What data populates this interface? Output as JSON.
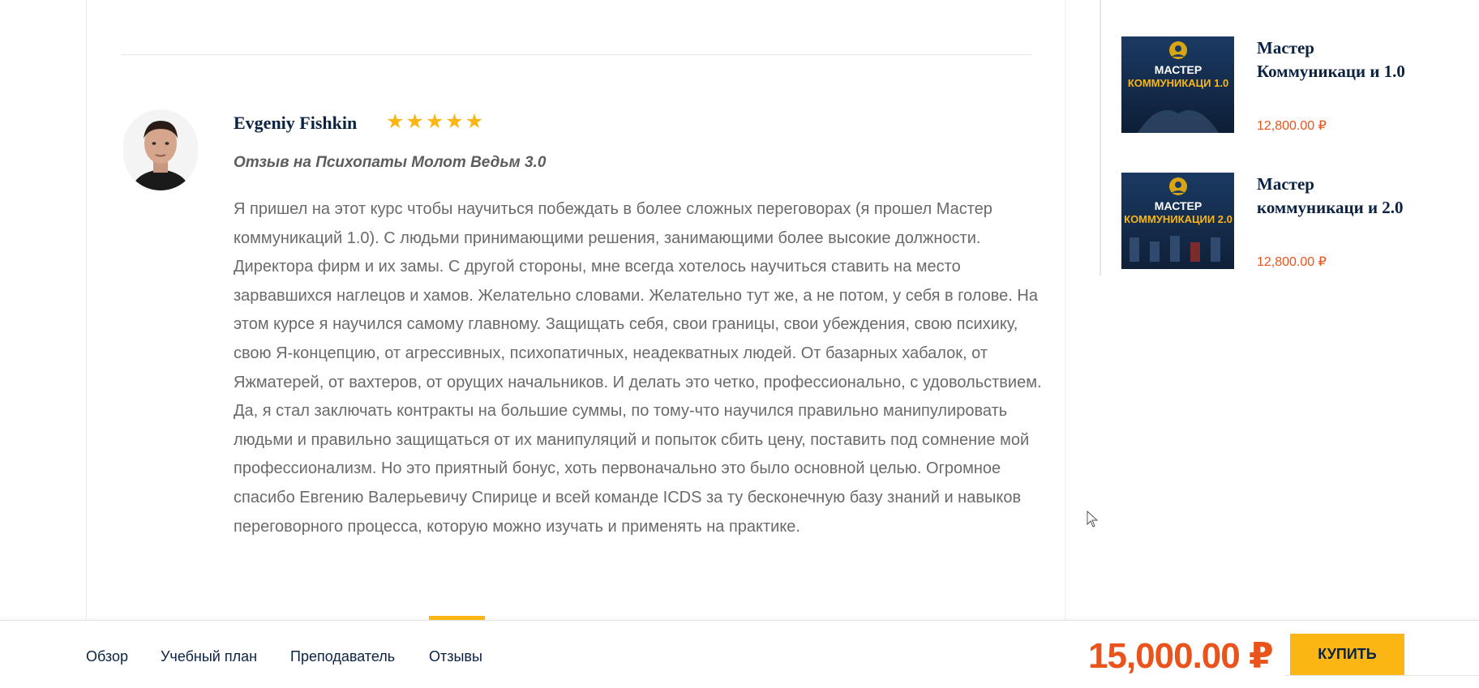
{
  "review": {
    "author": "Evgeniy Fishkin",
    "rating": 5,
    "stars": [
      "★",
      "★",
      "★",
      "★",
      "★"
    ],
    "title": "Отзыв на Психопаты Молот Ведьм 3.0",
    "body": "Я пришел на этот курс чтобы научиться побеждать в более сложных переговорах (я прошел Мастер коммуникаций 1.0). С людьми принимающими решения, занимающими более высокие должности. Директора фирм и их замы. С другой стороны, мне всегда хотелось научиться ставить на место зарвавшихся наглецов и хамов. Желательно словами. Желательно тут же, а не потом, у себя в голове. На этом курсе я научился самому главному. Защищать себя, свои границы, свои убеждения, свою психику, свою Я-концепцию, от агрессивных, психопатичных, неадекватных людей. От базарных хабалок, от Яжматерей, от вахтеров, от орущих начальников. И делать это четко, профессионально, с удовольствием. Да, я стал заключать контракты на большие суммы, по тому-что научился правильно манипулировать людьми и правильно защищаться от их манипуляций и попыток сбить цену, поставить под сомнение мой профессионализм. Но это приятный бонус, хоть первоначально это было основной целью. Огромное спасибо Евгению Валерьевичу Спирице и всей команде ICDS за ту бесконечную базу знаний и навыков переговорного процесса, которую можно изучать и применять на практике."
  },
  "sidebar": {
    "courses": [
      {
        "name": "Мастер Коммуникаци и 1.0",
        "price": "12,800.00 ₽",
        "thumb_line1": "МАСТЕР",
        "thumb_line2": "КОММУНИКАЦИ 1.0"
      },
      {
        "name": "Мастер коммуникаци и 2.0",
        "price": "12,800.00 ₽",
        "thumb_line1": "МАСТЕР",
        "thumb_line2": "КОММУНИКАЦИИ 2.0"
      }
    ]
  },
  "tabs": [
    {
      "label": "Обзор",
      "active": false
    },
    {
      "label": "Учебный план",
      "active": false
    },
    {
      "label": "Преподаватель",
      "active": false
    },
    {
      "label": "Отзывы",
      "active": true
    }
  ],
  "purchase": {
    "price": "15,000.00 ₽",
    "buy_label": "КУПИТЬ"
  },
  "colors": {
    "accent": "#fbb614",
    "price": "#e8541c",
    "heading": "#0b2241"
  }
}
